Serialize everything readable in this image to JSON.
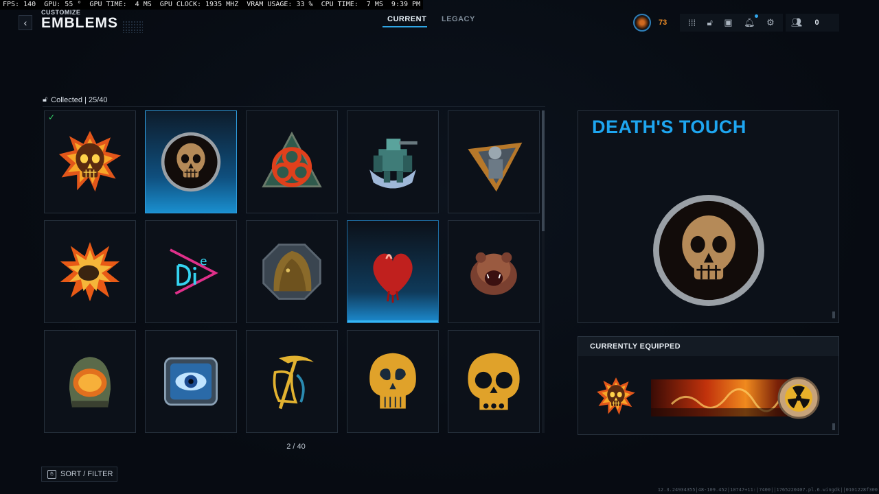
{
  "perf_overlay": "FPS: 140  GPU: 55 °  GPU TIME:  4 MS  GPU CLOCK: 1935 MHZ  VRAM USAGE: 33 %  CPU TIME:  7 MS  9:39 PM",
  "header": {
    "subtitle": "CUSTOMIZE",
    "title": "EMBLEMS",
    "tabs": [
      {
        "label": "CURRENT",
        "active": true
      },
      {
        "label": "LEGACY",
        "active": false
      }
    ],
    "player_level": "73",
    "friends_online": "0",
    "icons": [
      "apps-icon",
      "lock-icon",
      "camera-icon",
      "bell-icon",
      "gear-icon",
      "friends-icon"
    ]
  },
  "collection": {
    "label": "Collected | 25/40"
  },
  "grid": {
    "items": [
      {
        "icon": "flaming-skull-emblem",
        "equipped": true,
        "state": "normal"
      },
      {
        "icon": "deaths-touch-skull-emblem",
        "equipped": false,
        "state": "selected"
      },
      {
        "icon": "biohazard-emblem",
        "equipped": false,
        "state": "normal"
      },
      {
        "icon": "mech-robot-emblem",
        "equipped": false,
        "state": "normal"
      },
      {
        "icon": "soldier-triangle-emblem",
        "equipped": false,
        "state": "normal"
      },
      {
        "icon": "explosion-emblem",
        "equipped": false,
        "state": "normal"
      },
      {
        "icon": "neon-die-emblem",
        "equipped": false,
        "state": "normal"
      },
      {
        "icon": "ghillie-emblem",
        "equipped": false,
        "state": "normal"
      },
      {
        "icon": "bleeding-heart-emblem",
        "equipped": false,
        "state": "hover"
      },
      {
        "icon": "roaring-bear-emblem",
        "equipped": false,
        "state": "normal"
      },
      {
        "icon": "molten-helmet-emblem",
        "equipped": false,
        "state": "normal"
      },
      {
        "icon": "cyber-eye-emblem",
        "equipped": false,
        "state": "normal"
      },
      {
        "icon": "reaper-scythe-emblem",
        "equipped": false,
        "state": "normal"
      },
      {
        "icon": "gold-skull-emblem",
        "equipped": false,
        "state": "normal"
      },
      {
        "icon": "gold-skull-outline-emblem",
        "equipped": false,
        "state": "normal"
      }
    ]
  },
  "pager": "2 / 40",
  "sort_filter": "SORT / FILTER",
  "detail": {
    "title": "DEATH'S TOUCH",
    "icon": "deaths-touch-skull-emblem"
  },
  "equipped": {
    "header": "CURRENTLY EQUIPPED",
    "emblem_icon": "flaming-skull-emblem",
    "calling_card_icon": "nuclear-fire-calling-card"
  },
  "build_string": "12.3.24934355|48-109.452|10747+11:|7400||1765220407.pl.6.wingdk||0101228f300",
  "colors": {
    "accent": "#1ea6f0",
    "level": "#e98a26",
    "check": "#34d36a"
  }
}
